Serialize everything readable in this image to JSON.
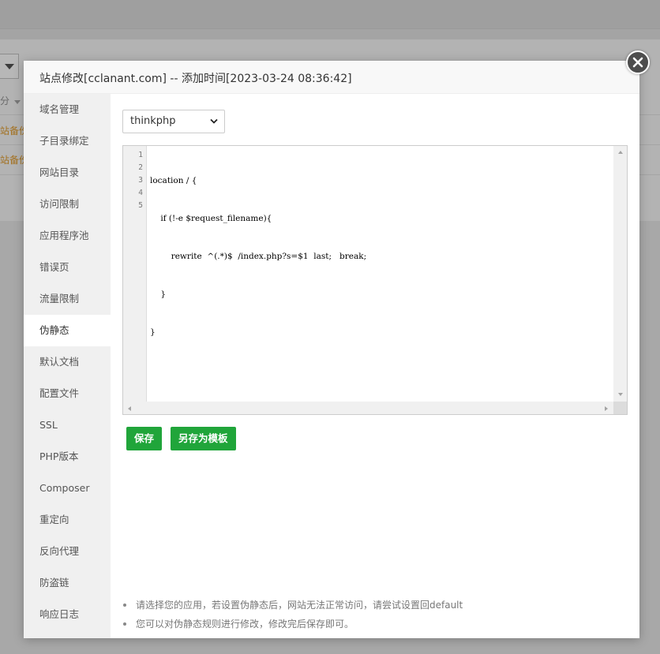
{
  "background": {
    "table_header_fragment": "分",
    "row_fragments": [
      "站备份",
      "站备份"
    ]
  },
  "dialog": {
    "title": "站点修改[cclanant.com] -- 添加时间[2023-03-24 08:36:42]",
    "close_icon": "close-icon"
  },
  "sidebar": {
    "active": "伪静态",
    "items": [
      {
        "label": "域名管理"
      },
      {
        "label": "子目录绑定"
      },
      {
        "label": "网站目录"
      },
      {
        "label": "访问限制"
      },
      {
        "label": "应用程序池"
      },
      {
        "label": "错误页"
      },
      {
        "label": "流量限制"
      },
      {
        "label": "伪静态"
      },
      {
        "label": "默认文档"
      },
      {
        "label": "配置文件"
      },
      {
        "label": "SSL"
      },
      {
        "label": "PHP版本"
      },
      {
        "label": "Composer"
      },
      {
        "label": "重定向"
      },
      {
        "label": "反向代理"
      },
      {
        "label": "防盗链"
      },
      {
        "label": "响应日志"
      }
    ]
  },
  "rewrite": {
    "selected_template": "thinkphp",
    "code_lines": [
      {
        "num": "1",
        "text": "location / {"
      },
      {
        "num": "2",
        "text": "    if (!-e $request_filename){"
      },
      {
        "num": "3",
        "text": "        rewrite  ^(.*)$  /index.php?s=$1  last;   break;"
      },
      {
        "num": "4",
        "text": "    }"
      },
      {
        "num": "5",
        "text": "}"
      }
    ],
    "save_label": "保存",
    "save_as_template_label": "另存为模板"
  },
  "tips": [
    "请选择您的应用，若设置伪静态后，网站无法正常访问，请尝试设置回default",
    "您可以对伪静态规则进行修改，修改完后保存即可。"
  ],
  "colors": {
    "accent": "#20a53a",
    "sidebar_bg": "#f0f0f0",
    "close_button": "#4d4d4d"
  }
}
